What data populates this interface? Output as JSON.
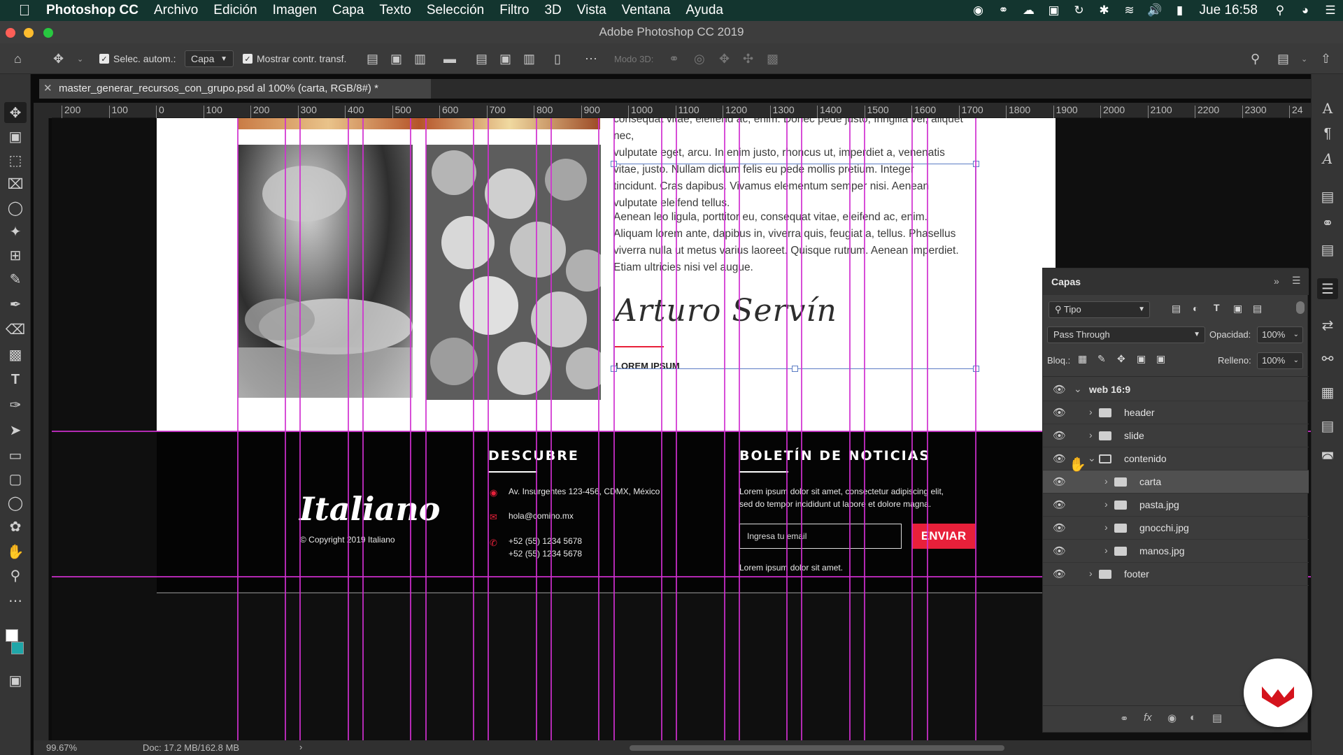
{
  "menubar": {
    "app": "Photoshop CC",
    "items": [
      "Archivo",
      "Edición",
      "Imagen",
      "Capa",
      "Texto",
      "Selección",
      "Filtro",
      "3D",
      "Vista",
      "Ventana",
      "Ayuda"
    ],
    "clock": "Jue 16:58"
  },
  "window": {
    "title": "Adobe Photoshop CC 2019"
  },
  "options": {
    "auto_select_label": "Selec. autom.:",
    "auto_select_value": "Capa",
    "show_transform_label": "Mostrar contr. transf.",
    "mode3d_label": "Modo 3D:"
  },
  "document_tab": {
    "title": "master_generar_recursos_con_grupo.psd al 100% (carta, RGB/8#) *"
  },
  "ruler": {
    "h_ticks": [
      "200",
      "100",
      "0",
      "100",
      "200",
      "300",
      "400",
      "500",
      "600",
      "700",
      "800",
      "900",
      "1000",
      "1100",
      "1200",
      "1300",
      "1400",
      "1500",
      "1600",
      "1700",
      "1800",
      "1900",
      "2000",
      "2100",
      "2200",
      "2300",
      "24"
    ]
  },
  "content": {
    "para1_lines": [
      "consequat vitae, eleifend ac, enim. Donec pede justo, fringilla vel, aliquet nec,",
      "vulputate eget, arcu. In enim justo, rhoncus ut, imperdiet a, venenatis",
      "vitae, justo. Nullam dictum felis eu pede mollis pretium. Integer",
      "tincidunt. Cras dapibus. Vivamus elementum semper nisi. Aenean",
      "vulputate eleifend tellus."
    ],
    "para2_lines": [
      "Aenean leo ligula, porttitor eu, consequat vitae, eleifend ac, enim.",
      "Aliquam lorem ante, dapibus in, viverra quis, feugiat a, tellus. Phasellus",
      "viverra nulla ut metus varius laoreet. Quisque rutrum. Aenean imperdiet.",
      "Etiam ultricies nisi vel augue."
    ],
    "signature": "Arturo Servín",
    "caption": "LOREM IPSUM"
  },
  "footer": {
    "logo": "Italiano",
    "copyright": "© Copyright 2019 Italiano",
    "discover_title": "DESCUBRE",
    "address": "Av. Insurgentes 123-456, CDMX, México",
    "email": "hola@comino.mx",
    "phone1": "+52 (55) 1234 5678",
    "phone2": "+52 (55) 1234 5678",
    "newsletter_title": "BOLETÍN DE NOTICIAS",
    "newsletter_text1": "Lorem ipsum dolor sit amet, consectetur adipiscing elit,",
    "newsletter_text2": "sed do  tempor incididunt ut labore et dolore magna.",
    "email_placeholder": "Ingresa tu email",
    "send_button": "ENVIAR",
    "newsletter_note": "Lorem ipsum dolor sit amet.",
    "accent_color": "#e8203a"
  },
  "status": {
    "zoom": "99.67%",
    "doc": "Doc: 17.2 MB/162.8 MB"
  },
  "layers_panel": {
    "title": "Capas",
    "filter": "Tipo",
    "blend_mode": "Pass Through",
    "opacity_label": "Opacidad:",
    "opacity_value": "100%",
    "lock_label": "Bloq.:",
    "fill_label": "Relleno:",
    "fill_value": "100%",
    "layers": [
      {
        "name": "web 16:9"
      },
      {
        "name": "header"
      },
      {
        "name": "slide"
      },
      {
        "name": "contenido"
      },
      {
        "name": "carta"
      },
      {
        "name": "pasta.jpg"
      },
      {
        "name": "gnocchi.jpg"
      },
      {
        "name": "manos.jpg"
      },
      {
        "name": "footer"
      }
    ]
  },
  "colors": {
    "guide": "#d02fd0",
    "menubar": "#13352f"
  }
}
